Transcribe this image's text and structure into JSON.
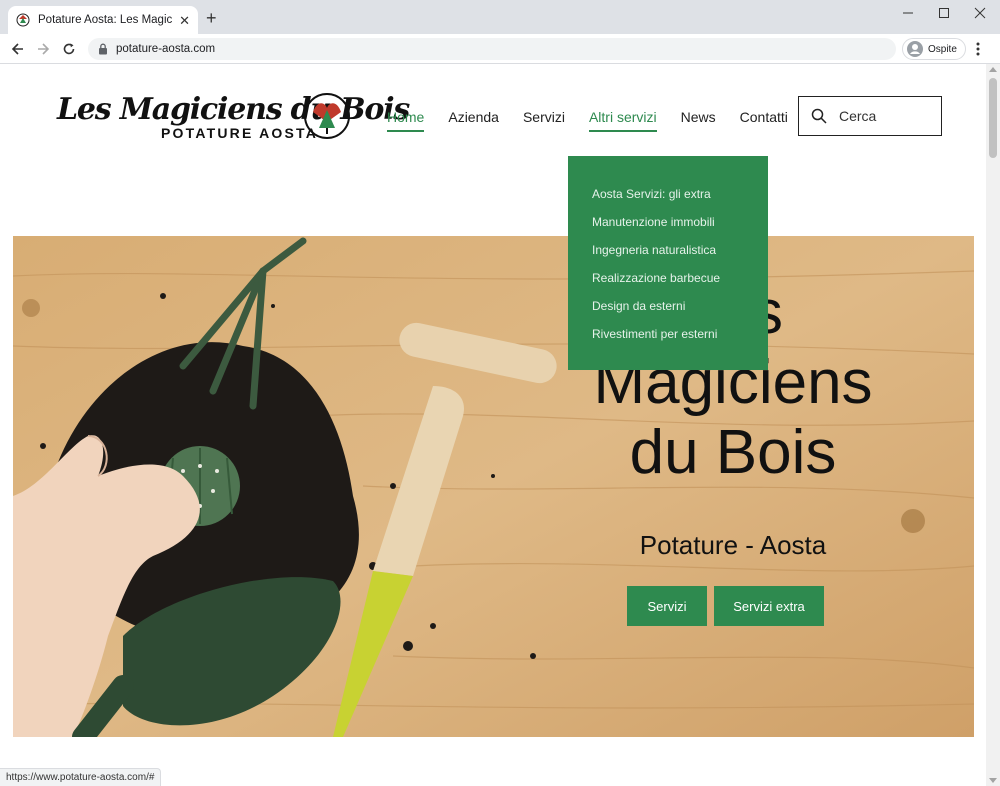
{
  "browser": {
    "tab_title": "Potature Aosta: Les Magiciens du",
    "url": "potature-aosta.com",
    "profile_label": "Ospite",
    "status_url": "https://www.potature-aosta.com/#"
  },
  "header": {
    "logo_script": "Les Magiciens du Bois",
    "logo_sub": "POTATURE AOSTA",
    "nav": [
      "Home",
      "Azienda",
      "Servizi",
      "Altri servizi",
      "News",
      "Contatti"
    ],
    "search_placeholder": "Cerca"
  },
  "dropdown": {
    "items": [
      "Aosta Servizi: gli extra",
      "Manutenzione immobili",
      "Ingegneria naturalistica",
      "Realizzazione barbecue",
      "Design da esterni",
      "Rivestimenti per esterni"
    ]
  },
  "hero": {
    "title_lines": [
      "Les",
      "Magiciens",
      "du Bois"
    ],
    "subtitle": "Potature - Aosta",
    "buttons": [
      "Servizi",
      "Servizi extra"
    ]
  },
  "colors": {
    "accent": "#2e8a4f",
    "wood": "#d9b27a",
    "tabstrip": "#dee1e6"
  }
}
